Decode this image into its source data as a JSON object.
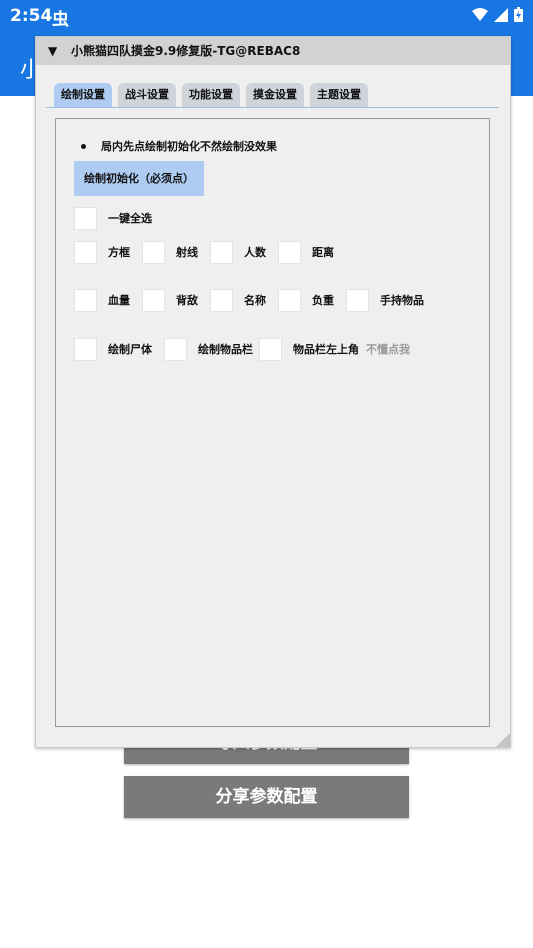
{
  "status_bar": {
    "time": "2:54",
    "notification_icon": "bug-icon",
    "icons": [
      "wifi-icon",
      "signal-icon",
      "battery-icon"
    ]
  },
  "app": {
    "title_fragment": "小",
    "accent_color": "#1877e3"
  },
  "background_buttons": {
    "import_label": "导入参数配置",
    "share_label": "分享参数配置"
  },
  "window": {
    "title": "小熊猫四队摸金9.9修复版-TG@REBAC8",
    "collapse_icon": "triangle-down-icon",
    "tabs": [
      {
        "label": "绘制设置",
        "active": true
      },
      {
        "label": "战斗设置",
        "active": false
      },
      {
        "label": "功能设置",
        "active": false
      },
      {
        "label": "摸金设置",
        "active": false
      },
      {
        "label": "主题设置",
        "active": false
      }
    ],
    "note": "局内先点绘制初始化不然绘制没效果",
    "init_button": "绘制初始化（必须点）",
    "select_all": "一键全选",
    "row1": [
      "方框",
      "射线",
      "人数",
      "距离"
    ],
    "row2": [
      "血量",
      "背敌",
      "名称",
      "负重",
      "手持物品"
    ],
    "row3": [
      "绘制尸体",
      "绘制物品栏",
      "物品栏左上角"
    ],
    "row3_hint": "不懂点我"
  }
}
